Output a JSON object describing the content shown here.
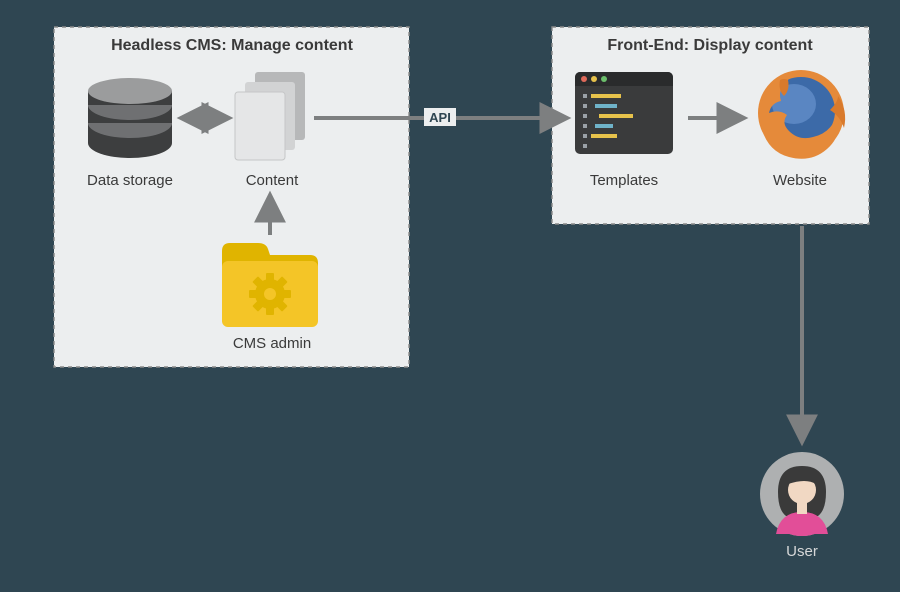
{
  "left_panel": {
    "title": "Headless CMS: Manage content"
  },
  "right_panel": {
    "title": "Front-End: Display content"
  },
  "nodes": {
    "storage": {
      "label": "Data storage"
    },
    "content": {
      "label": "Content"
    },
    "cmsadmin": {
      "label": "CMS admin"
    },
    "templates": {
      "label": "Templates"
    },
    "website": {
      "label": "Website"
    },
    "user": {
      "label": "User"
    }
  },
  "edges": {
    "api": {
      "label": "API"
    }
  }
}
